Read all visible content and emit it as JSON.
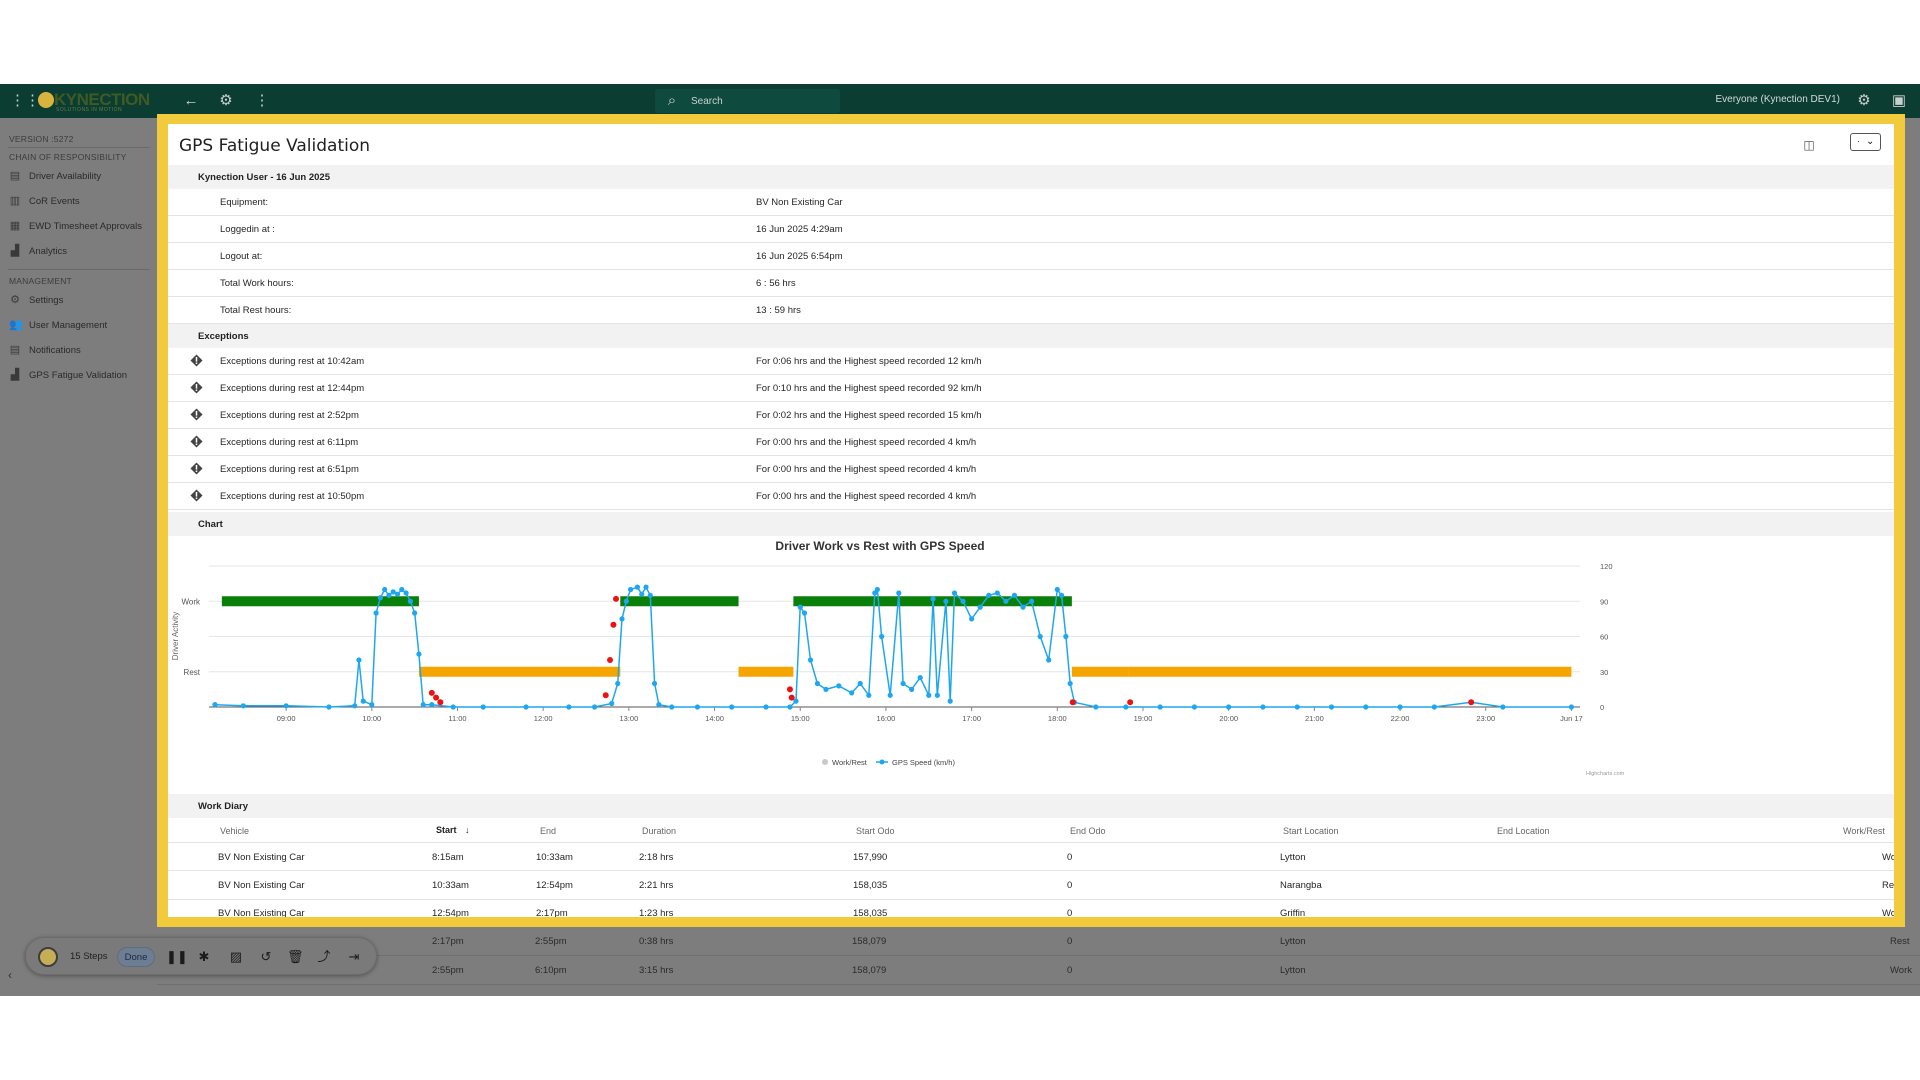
{
  "topbar": {
    "logo_text": "KYNECTION",
    "logo_tagline": "SOLUTIONS IN MOTION",
    "search_placeholder": "Search",
    "user_context": "Everyone (Kynection DEV1)"
  },
  "sidebar": {
    "version": "VERSION :5272",
    "sections": [
      {
        "title": "CHAIN OF RESPONSIBILITY",
        "items": [
          "Driver Availability",
          "CoR Events",
          "EWD Timesheet Approvals",
          "Analytics"
        ]
      },
      {
        "title": "MANAGEMENT",
        "items": [
          "Settings",
          "User Management",
          "Notifications",
          "GPS Fatigue Validation"
        ]
      }
    ]
  },
  "modal": {
    "title": "GPS Fatigue Validation",
    "dropdown_value": "·",
    "user_section": "Kynection User - 16 Jun 2025",
    "summary": [
      {
        "label": "Equipment:",
        "value": "BV Non Existing Car"
      },
      {
        "label": "Loggedin at :",
        "value": "16 Jun 2025 4:29am"
      },
      {
        "label": "Logout at:",
        "value": "16 Jun 2025 6:54pm"
      },
      {
        "label": "Total Work hours:",
        "value": "6 : 56 hrs"
      },
      {
        "label": "Total Rest hours:",
        "value": "13 : 59 hrs"
      }
    ],
    "exceptions_section": "Exceptions",
    "exceptions": [
      {
        "label": "Exceptions during rest at 10:42am",
        "value": "For 0:06 hrs and the Highest speed recorded 12 km/h"
      },
      {
        "label": "Exceptions during rest at 12:44pm",
        "value": "For 0:10 hrs and the Highest speed recorded 92 km/h"
      },
      {
        "label": "Exceptions during rest at 2:52pm",
        "value": "For 0:02 hrs and the Highest speed recorded 15 km/h"
      },
      {
        "label": "Exceptions during rest at 6:11pm",
        "value": "For 0:00 hrs and the Highest speed recorded 4 km/h"
      },
      {
        "label": "Exceptions during rest at 6:51pm",
        "value": "For 0:00 hrs and the Highest speed recorded 4 km/h"
      },
      {
        "label": "Exceptions during rest at 10:50pm",
        "value": "For 0:00 hrs and the Highest speed recorded 4 km/h"
      }
    ],
    "chart_section": "Chart",
    "work_diary_section": "Work Diary",
    "work_diary": {
      "columns": [
        "Vehicle",
        "Start",
        "End",
        "Duration",
        "Start Odo",
        "End Odo",
        "Start Location",
        "End Location",
        "Work/Rest"
      ],
      "sort_indicator": "↓",
      "rows": [
        [
          "BV Non Existing Car",
          "8:15am",
          "10:33am",
          "2:18 hrs",
          "157,990",
          "0",
          "Lytton",
          "",
          "Work"
        ],
        [
          "BV Non Existing Car",
          "10:33am",
          "12:54pm",
          "2:21 hrs",
          "158,035",
          "0",
          "Narangba",
          "",
          "Rest"
        ],
        [
          "BV Non Existing Car",
          "12:54pm",
          "2:17pm",
          "1:23 hrs",
          "158,035",
          "0",
          "Griffin",
          "",
          "Work"
        ]
      ]
    }
  },
  "background_rows": [
    [
      "2:17pm",
      "2:55pm",
      "0:38 hrs",
      "158,079",
      "0",
      "Lytton",
      "Rest"
    ],
    [
      "2:55pm",
      "6:10pm",
      "3:15 hrs",
      "158,079",
      "0",
      "Lytton",
      "Work"
    ]
  ],
  "recorder": {
    "steps": "15 Steps",
    "done": "Done"
  },
  "chart_data": {
    "type": "line",
    "title": "Driver Work vs Rest with GPS Speed",
    "ylabel_left": "Driver Activity",
    "left_categories": [
      "Rest",
      "Work"
    ],
    "ylabel_right": "",
    "ylim_right": [
      0,
      120
    ],
    "right_ticks": [
      0,
      30,
      60,
      90,
      120
    ],
    "x_ticks": [
      "09:00",
      "10:00",
      "11:00",
      "12:00",
      "13:00",
      "14:00",
      "15:00",
      "16:00",
      "17:00",
      "18:00",
      "19:00",
      "20:00",
      "21:00",
      "22:00",
      "23:00",
      "Jun 17"
    ],
    "x_range_hours": [
      8.1,
      24.1
    ],
    "legend": [
      "Work/Rest",
      "GPS Speed (km/h)"
    ],
    "legend_position": "bottom-center",
    "credit": "Highcharts.com",
    "colors": {
      "work": "#0a7f0a",
      "rest": "#f5a400",
      "speed": "#1ea7f0",
      "exception": "#ee1111"
    },
    "work_rest_segments": [
      {
        "state": "Work",
        "start": 8.25,
        "end": 10.55
      },
      {
        "state": "Rest",
        "start": 10.55,
        "end": 12.9
      },
      {
        "state": "Work",
        "start": 12.9,
        "end": 14.28
      },
      {
        "state": "Rest",
        "start": 14.28,
        "end": 14.92
      },
      {
        "state": "Work",
        "start": 14.92,
        "end": 18.17
      },
      {
        "state": "Rest",
        "start": 18.17,
        "end": 18.83
      },
      {
        "state": "Rest",
        "start": 18.83,
        "end": 24.0
      }
    ],
    "speed_series": [
      [
        8.17,
        2
      ],
      [
        8.5,
        1
      ],
      [
        9.0,
        1
      ],
      [
        9.5,
        0
      ],
      [
        9.8,
        1
      ],
      [
        9.85,
        40
      ],
      [
        9.9,
        5
      ],
      [
        10.0,
        2
      ],
      [
        10.05,
        80
      ],
      [
        10.1,
        93
      ],
      [
        10.15,
        100
      ],
      [
        10.2,
        95
      ],
      [
        10.25,
        98
      ],
      [
        10.3,
        96
      ],
      [
        10.35,
        100
      ],
      [
        10.4,
        97
      ],
      [
        10.45,
        90
      ],
      [
        10.5,
        80
      ],
      [
        10.55,
        45
      ],
      [
        10.6,
        2
      ],
      [
        10.7,
        2
      ],
      [
        10.95,
        0
      ],
      [
        11.3,
        0
      ],
      [
        11.8,
        0
      ],
      [
        12.3,
        0
      ],
      [
        12.6,
        0
      ],
      [
        12.8,
        3
      ],
      [
        12.87,
        20
      ],
      [
        12.92,
        75
      ],
      [
        12.97,
        90
      ],
      [
        13.02,
        100
      ],
      [
        13.1,
        102
      ],
      [
        13.15,
        96
      ],
      [
        13.2,
        102
      ],
      [
        13.25,
        95
      ],
      [
        13.3,
        20
      ],
      [
        13.35,
        2
      ],
      [
        13.5,
        0
      ],
      [
        13.8,
        0
      ],
      [
        14.2,
        0
      ],
      [
        14.6,
        0
      ],
      [
        14.88,
        0
      ],
      [
        14.95,
        5
      ],
      [
        15.0,
        85
      ],
      [
        15.05,
        80
      ],
      [
        15.12,
        40
      ],
      [
        15.2,
        20
      ],
      [
        15.3,
        15
      ],
      [
        15.45,
        18
      ],
      [
        15.6,
        12
      ],
      [
        15.7,
        20
      ],
      [
        15.8,
        10
      ],
      [
        15.87,
        97
      ],
      [
        15.9,
        100
      ],
      [
        15.95,
        60
      ],
      [
        16.05,
        10
      ],
      [
        16.15,
        97
      ],
      [
        16.2,
        20
      ],
      [
        16.3,
        15
      ],
      [
        16.4,
        25
      ],
      [
        16.5,
        10
      ],
      [
        16.55,
        92
      ],
      [
        16.6,
        10
      ],
      [
        16.7,
        90
      ],
      [
        16.75,
        5
      ],
      [
        16.8,
        97
      ],
      [
        16.9,
        90
      ],
      [
        17.0,
        75
      ],
      [
        17.1,
        85
      ],
      [
        17.2,
        95
      ],
      [
        17.3,
        97
      ],
      [
        17.4,
        90
      ],
      [
        17.5,
        95
      ],
      [
        17.6,
        85
      ],
      [
        17.7,
        90
      ],
      [
        17.8,
        60
      ],
      [
        17.9,
        40
      ],
      [
        18.0,
        100
      ],
      [
        18.05,
        95
      ],
      [
        18.1,
        60
      ],
      [
        18.15,
        20
      ],
      [
        18.2,
        4
      ],
      [
        18.45,
        0
      ],
      [
        18.8,
        0
      ],
      [
        19.2,
        0
      ],
      [
        19.6,
        0
      ],
      [
        20.0,
        0
      ],
      [
        20.4,
        0
      ],
      [
        20.8,
        0
      ],
      [
        21.2,
        0
      ],
      [
        21.6,
        0
      ],
      [
        22.0,
        0
      ],
      [
        22.4,
        0
      ],
      [
        22.83,
        4
      ],
      [
        23.2,
        0
      ],
      [
        24.0,
        0
      ]
    ],
    "exception_points": [
      [
        10.7,
        12
      ],
      [
        10.75,
        8
      ],
      [
        10.8,
        4
      ],
      [
        12.73,
        10
      ],
      [
        12.78,
        40
      ],
      [
        12.82,
        70
      ],
      [
        12.85,
        92
      ],
      [
        14.88,
        15
      ],
      [
        14.9,
        8
      ],
      [
        18.18,
        4
      ],
      [
        18.85,
        4
      ],
      [
        22.83,
        4
      ]
    ]
  }
}
